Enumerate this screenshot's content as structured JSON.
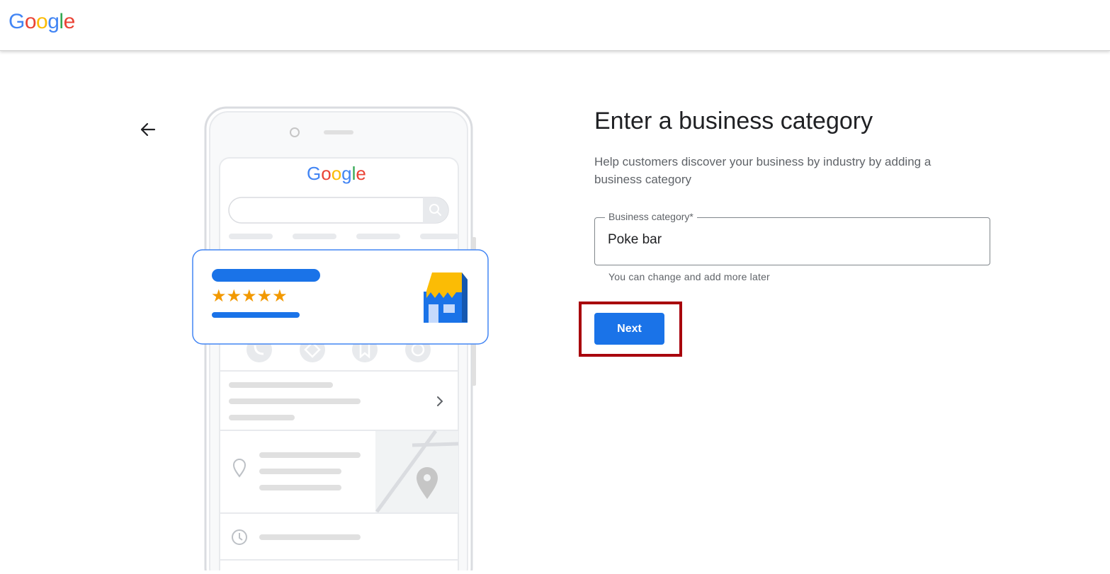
{
  "header": {
    "logo_letters": [
      "G",
      "o",
      "o",
      "g",
      "l",
      "e"
    ]
  },
  "phone": {
    "logo_letters": [
      "G",
      "o",
      "o",
      "g",
      "l",
      "e"
    ],
    "card_stars": "★★★★★"
  },
  "main": {
    "title": "Enter a business category",
    "description": "Help customers discover your business by industry by adding a business category",
    "field_label": "Business category*",
    "field_value": "Poke bar",
    "helper_text": "You can change and add more later",
    "next_label": "Next"
  },
  "colors": {
    "google_blue": "#4285F4",
    "google_red": "#EA4335",
    "google_yellow": "#FBBC05",
    "google_green": "#34A853",
    "button_blue": "#1a73e8",
    "highlight_red": "#a8000c"
  }
}
